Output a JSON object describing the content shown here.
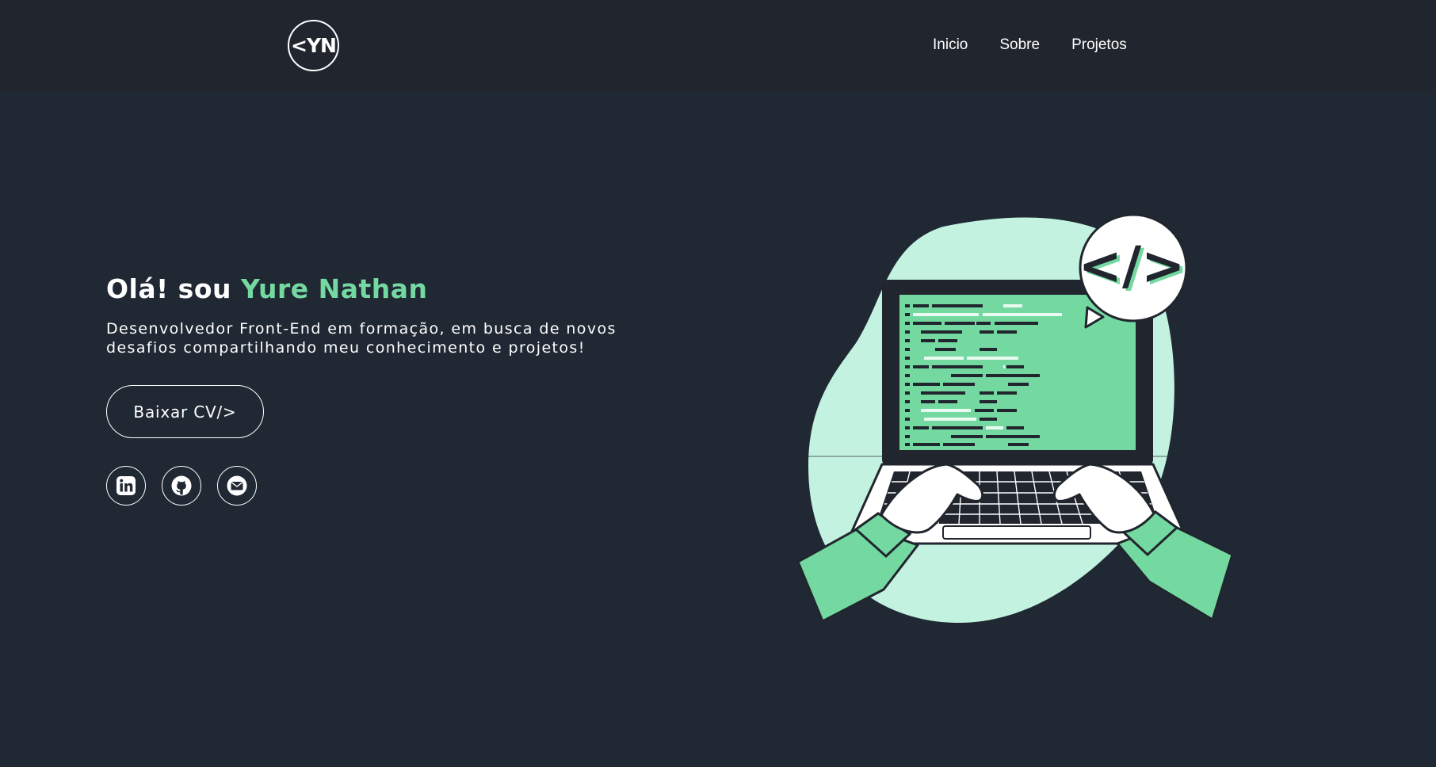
{
  "header": {
    "logo_text": "<YN",
    "nav": [
      {
        "label": "Inicio"
      },
      {
        "label": "Sobre"
      },
      {
        "label": "Projetos"
      }
    ]
  },
  "hero": {
    "greeting": "Olá! sou",
    "name": "Yure Nathan",
    "subtitle": "Desenvolvedor Front-End em formação, em busca de novos desafios compartilhando meu conhecimento e projetos!",
    "cv_button": "Baixar CV/>",
    "socials": [
      {
        "icon": "linkedin-icon"
      },
      {
        "icon": "github-icon"
      },
      {
        "icon": "email-icon"
      }
    ],
    "code_bubble_text": "</>"
  },
  "colors": {
    "background": "#202833",
    "header_background": "#21262e",
    "accent": "#73d9a1",
    "light_accent": "#c3f2e0",
    "text": "#ffffff"
  }
}
